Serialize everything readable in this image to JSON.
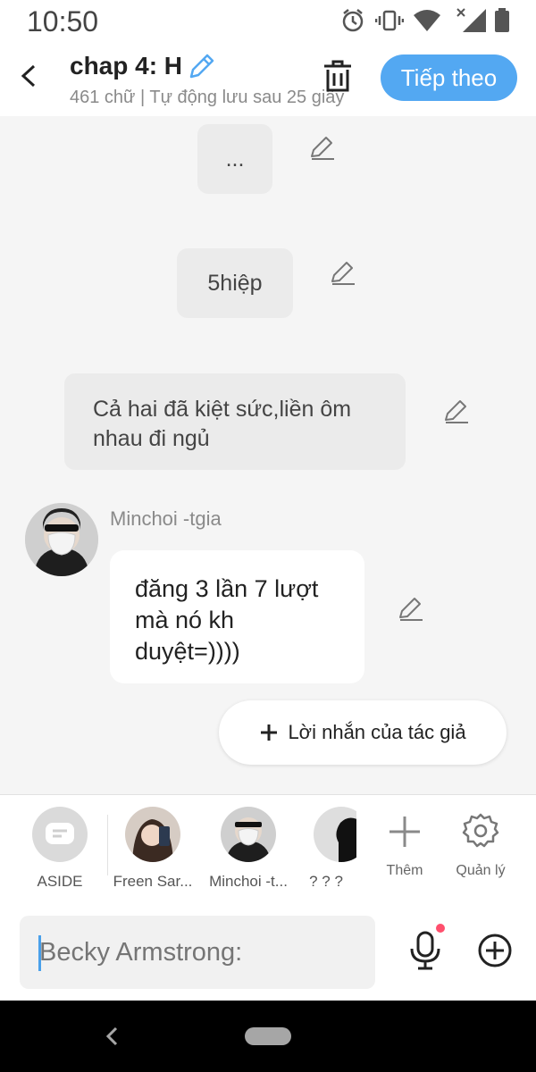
{
  "status_bar": {
    "time": "10:50"
  },
  "header": {
    "title": "chap 4: H",
    "subtitle": "461 chữ | Tự động lưu sau 25 giây",
    "next_label": "Tiếp theo"
  },
  "messages": [
    {
      "text": "..."
    },
    {
      "text": "5hiệp"
    },
    {
      "text": "Cả hai đã kiệt sức,liền ôm nhau đi ngủ"
    },
    {
      "author": "Minchoi -tgia",
      "text": "đăng 3 lần 7 lượt mà nó kh duyệt=))))"
    }
  ],
  "author_note_label": "Lời nhắn của tác giả",
  "characters": [
    {
      "label": "ASIDE"
    },
    {
      "label": "Freen Sar..."
    },
    {
      "label": "Minchoi -t..."
    },
    {
      "label": "? ? ?"
    }
  ],
  "char_actions": {
    "add_label": "Thêm",
    "manage_label": "Quản lý"
  },
  "input": {
    "placeholder": "Becky Armstrong:"
  },
  "colors": {
    "accent": "#53a8f2",
    "bubble": "#ebebeb",
    "background": "#f5f5f5",
    "mic_dot": "#ff4f6d"
  }
}
